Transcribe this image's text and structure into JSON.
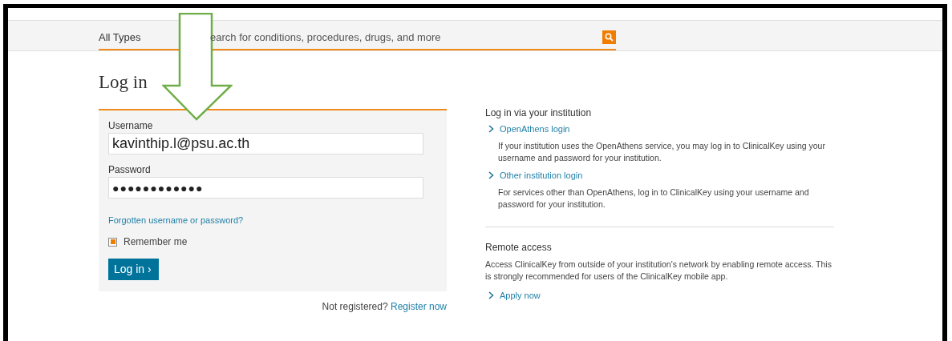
{
  "search": {
    "type_filter": "All Types",
    "placeholder": "earch for conditions, procedures, drugs, and more"
  },
  "login": {
    "title": "Log in",
    "fields": [
      {
        "label": "Username",
        "value": "kavinthip.l@psu.ac.th"
      },
      {
        "label": "Password",
        "value": "●●●●●●●●●●●●"
      }
    ],
    "forgot_link": "Forgotten username or password?",
    "remember_me": {
      "label": "Remember me",
      "checked": true
    },
    "submit": "Log in",
    "submit_icon": "›",
    "register_prompt": "Not registered?",
    "register_link": "Register now"
  },
  "institution": {
    "title": "Log in via your institution",
    "options": [
      {
        "link": "OpenAthens login",
        "description": "If your institution uses the OpenAthens service, you may log in to ClinicalKey using your username and password for your institution."
      },
      {
        "link": "Other institution login",
        "description": "For services other than OpenAthens, log in to ClinicalKey using your username and password for your institution."
      }
    ]
  },
  "remote_access": {
    "title": "Remote access",
    "description": "Access ClinicalKey from outside of your institution's network by enabling remote access. This is strongly recommended for users of the ClinicalKey mobile app.",
    "link": "Apply now"
  }
}
